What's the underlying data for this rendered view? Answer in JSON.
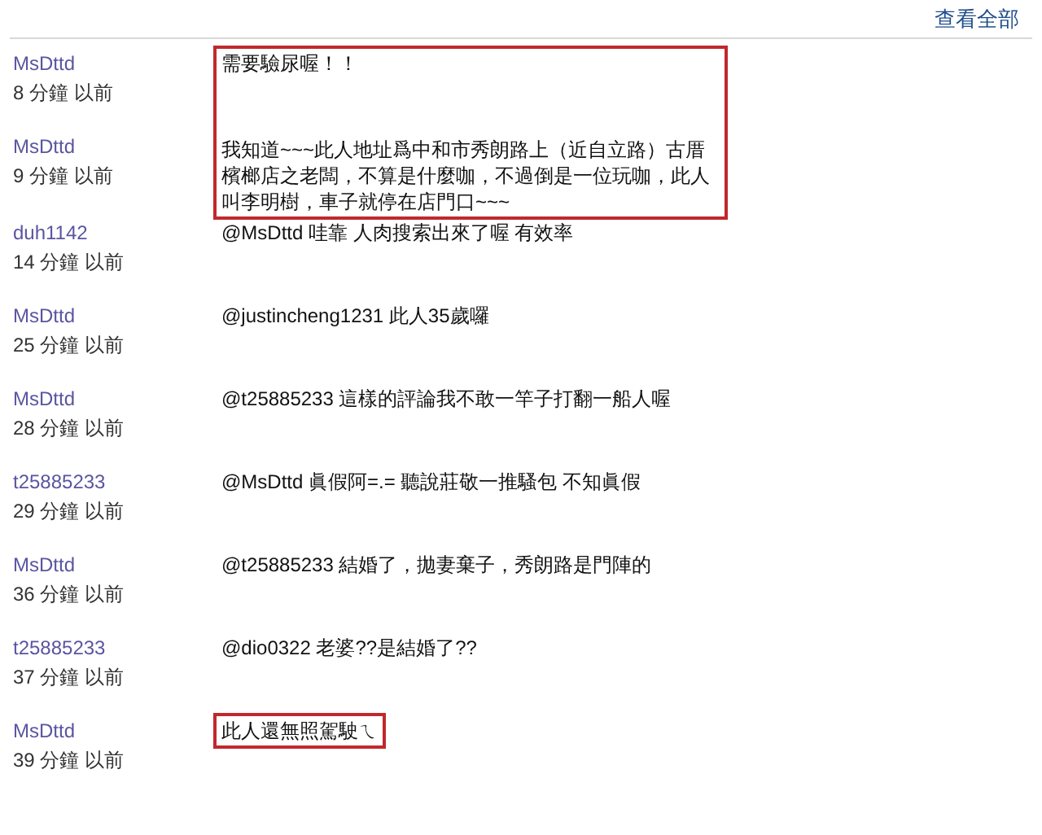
{
  "header": {
    "view_all_link": "查看全部"
  },
  "comments": [
    {
      "author": "MsDttd",
      "time": "8 分鐘 以前",
      "text": "需要驗尿喔！！",
      "highlighted": true
    },
    {
      "author": "MsDttd",
      "time": "9 分鐘 以前",
      "text": "我知道~~~此人地址爲中和市秀朗路上（近自立路）古厝檳榔店之老闆，不算是什麼咖，不過倒是一位玩咖，此人叫李明樹，車子就停在店門口~~~",
      "highlighted": true
    },
    {
      "author": "duh1142",
      "time": "14 分鐘 以前",
      "text": "@MsDttd 哇靠 人肉搜索出來了喔 有效率",
      "highlighted": false
    },
    {
      "author": "MsDttd",
      "time": "25 分鐘 以前",
      "text": "@justincheng1231 此人35歲囉",
      "highlighted": false
    },
    {
      "author": "MsDttd",
      "time": "28 分鐘 以前",
      "text": "@t25885233 這樣的評論我不敢一竿子打翻一船人喔",
      "highlighted": false
    },
    {
      "author": "t25885233",
      "time": "29 分鐘 以前",
      "text": "@MsDttd 眞假阿=.= 聽說莊敬一推騷包 不知眞假",
      "highlighted": false
    },
    {
      "author": "MsDttd",
      "time": "36 分鐘 以前",
      "text": "@t25885233 結婚了，拋妻棄子，秀朗路是門陣的",
      "highlighted": false
    },
    {
      "author": "t25885233",
      "time": "37 分鐘 以前",
      "text": "@dio0322 老婆??是結婚了??",
      "highlighted": false
    },
    {
      "author": "MsDttd",
      "time": "39 分鐘 以前",
      "text": "此人還無照駕駛ㄟ",
      "highlighted": true
    }
  ]
}
